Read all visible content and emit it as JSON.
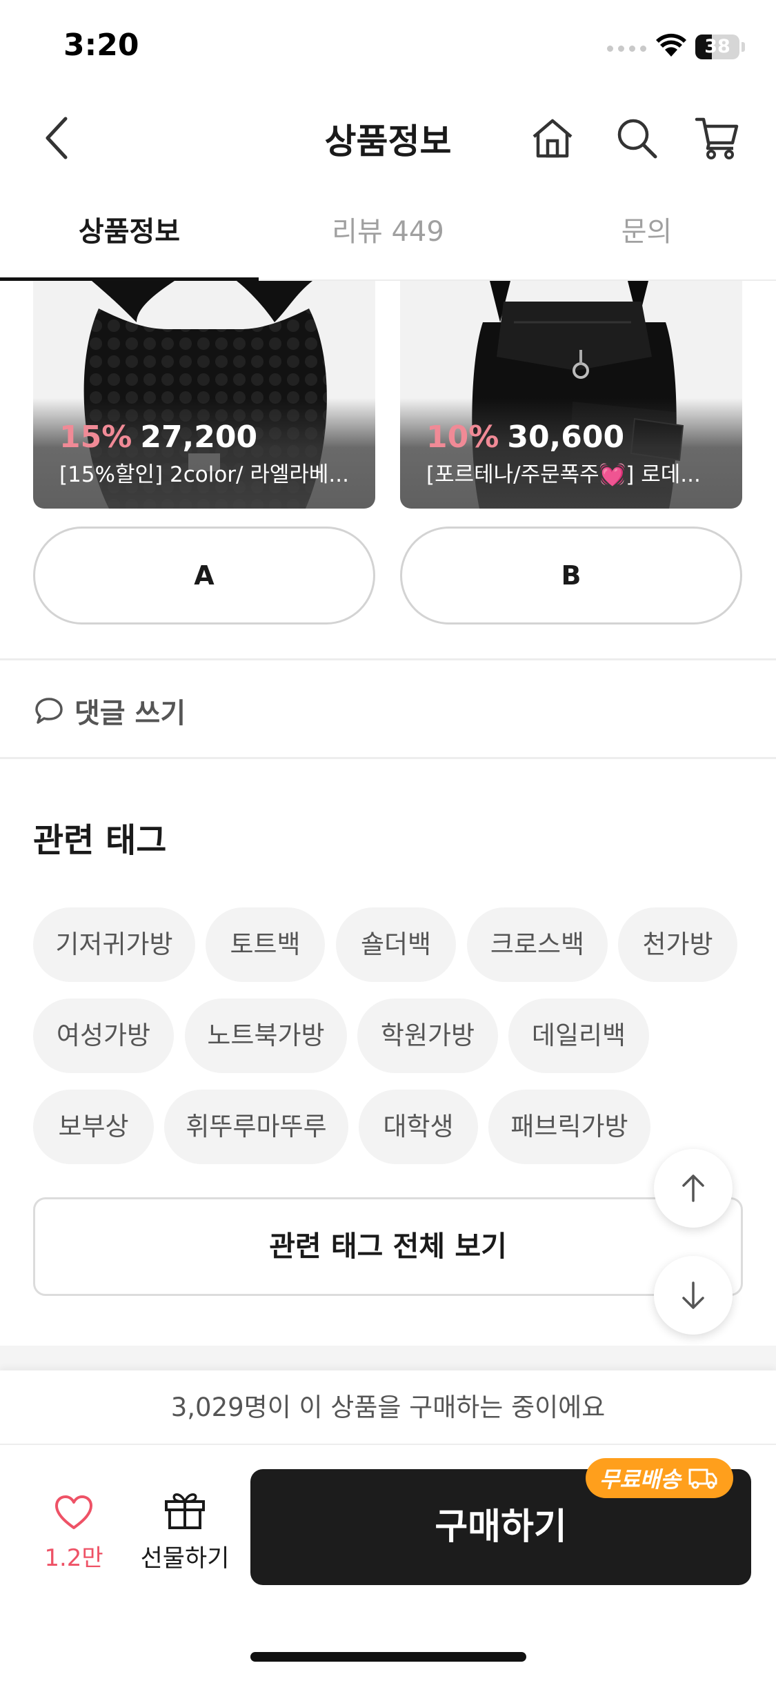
{
  "status_bar": {
    "time": "3:20",
    "battery": "38",
    "battery_level": 0.38
  },
  "header": {
    "title": "상품정보"
  },
  "tabs": [
    {
      "label": "상품정보",
      "active": true
    },
    {
      "label": "리뷰 449",
      "active": false
    },
    {
      "label": "문의",
      "active": false
    }
  ],
  "products": [
    {
      "discount": "15%",
      "price": "27,200",
      "name": "[15%할인] 2color/ 라엘라베...",
      "vote": "A"
    },
    {
      "discount": "10%",
      "price": "30,600",
      "name": "[포르테나/주문폭주💓] 로데...",
      "vote": "B"
    }
  ],
  "comment": {
    "label": "댓글 쓰기"
  },
  "related_tags": {
    "title": "관련 태그",
    "tags": [
      "기저귀가방",
      "토트백",
      "숄더백",
      "크로스백",
      "천가방",
      "여성가방",
      "노트북가방",
      "학원가방",
      "데일리백",
      "보부상",
      "휘뚜루마뚜루",
      "대학생",
      "패브릭가방"
    ],
    "view_all": "관련 태그 전체 보기"
  },
  "bottom": {
    "buyers_text": "3,029명이 이 상품을 구매하는 중이에요",
    "like_count": "1.2만",
    "gift_label": "선물하기",
    "buy_label": "구매하기",
    "free_shipping": "무료배송"
  },
  "colors": {
    "discount": "#f08a96",
    "like": "#ee5266",
    "badge": "#ff9f1c",
    "buy_button": "#1c1c1c"
  }
}
